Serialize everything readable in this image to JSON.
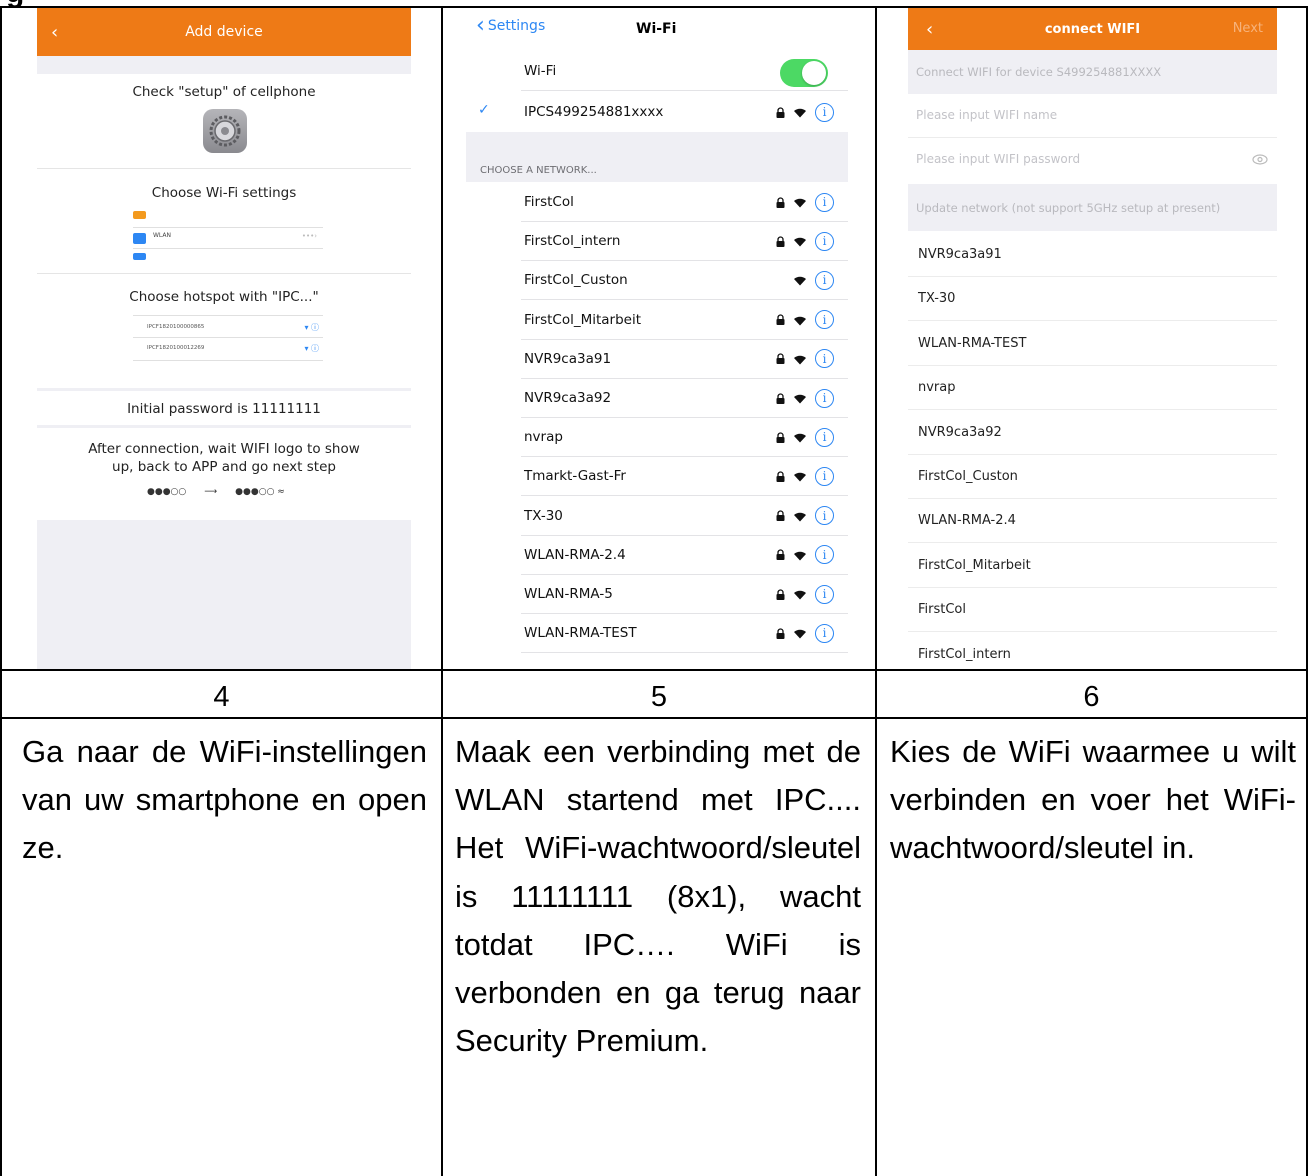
{
  "heading_fragment": "g",
  "screens": {
    "add_device": {
      "title": "Add device",
      "back": "‹",
      "step1": "Check \"setup\" of cellphone",
      "step2": "Choose Wi-Fi settings",
      "mini_wifi_label": "WLAN",
      "step3": "Choose hotspot with \"IPC...\"",
      "hotspots": [
        "IPCF1820100000865",
        "IPCF1820100012269"
      ],
      "password_note": "Initial password is 11111111",
      "after_note_1": "After connection, wait WIFI logo to show",
      "after_note_2": "up, back to APP and go next step",
      "colors": {
        "accent": "#ee7a16",
        "background": "#efeff4"
      }
    },
    "wifi_settings": {
      "back_label": "Settings",
      "title": "Wi-Fi",
      "wifi_label": "Wi-Fi",
      "wifi_on": true,
      "connected": "IPCS499254881xxxx",
      "section_header": "CHOOSE A NETWORK...",
      "networks": [
        {
          "name": "FirstCol",
          "locked": true
        },
        {
          "name": "FirstCol_intern",
          "locked": true
        },
        {
          "name": "FirstCol_Custon",
          "locked": false
        },
        {
          "name": "FirstCol_Mitarbeit",
          "locked": true
        },
        {
          "name": "NVR9ca3a91",
          "locked": true
        },
        {
          "name": "NVR9ca3a92",
          "locked": true
        },
        {
          "name": "nvrap",
          "locked": true
        },
        {
          "name": "Tmarkt-Gast-Fr",
          "locked": true
        },
        {
          "name": "TX-30",
          "locked": true
        },
        {
          "name": "WLAN-RMA-2.4",
          "locked": true
        },
        {
          "name": "WLAN-RMA-5",
          "locked": true
        },
        {
          "name": "WLAN-RMA-TEST",
          "locked": true
        }
      ],
      "colors": {
        "toggle": "#4cd964",
        "link": "#2d87f3"
      }
    },
    "connect_wifi": {
      "title": "connect WIFI",
      "back": "‹",
      "next": "Next",
      "device_line": "Connect WIFI for device S499254881XXXX",
      "name_placeholder": "Please input WIFI name",
      "password_placeholder": "Please input WIFI password",
      "update_note": "Update network (not support 5GHz setup at present)",
      "networks": [
        "NVR9ca3a91",
        "TX-30",
        "WLAN-RMA-TEST",
        "nvrap",
        "NVR9ca3a92",
        "FirstCol_Custon",
        "WLAN-RMA-2.4",
        "FirstCol_Mitarbeit",
        "FirstCol",
        "FirstCol_intern"
      ]
    }
  },
  "steps": [
    {
      "number": "4",
      "text": "Ga naar de WiFi-instellingen van uw smartphone en open ze."
    },
    {
      "number": "5",
      "text": "Maak een verbinding met de WLAN startend met IPC.... Het WiFi-wachtwoord/sleutel is 11111111 (8x1), wacht totdat IPC…. WiFi is verbonden en ga terug naar Security Premium."
    },
    {
      "number": "6",
      "text": "Kies de WiFi waarmee u wilt verbinden en voer het WiFi-wachtwoord/sleutel in."
    }
  ]
}
